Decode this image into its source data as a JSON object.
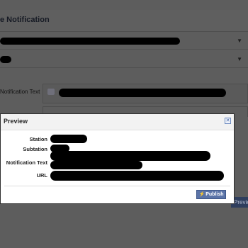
{
  "background": {
    "page_title": "e Notification",
    "notification_text_label": "Notification Text",
    "preview_button_label": "Preview"
  },
  "modal": {
    "title": "Preview",
    "rows": [
      {
        "label": "Station"
      },
      {
        "label": "Subtation"
      },
      {
        "label": "Notification Text"
      },
      {
        "label": "URL"
      }
    ],
    "publish_label": "Publish"
  },
  "icons": {
    "close": "close-icon",
    "dropdown": "chevron-down-icon",
    "publish": "lightning-icon",
    "text_field": "text-icon"
  },
  "colors": {
    "overlay": "#5d5d5d",
    "modal_bg": "#ffffff",
    "publish_button": "#5b74a8",
    "redaction": "#000000"
  }
}
